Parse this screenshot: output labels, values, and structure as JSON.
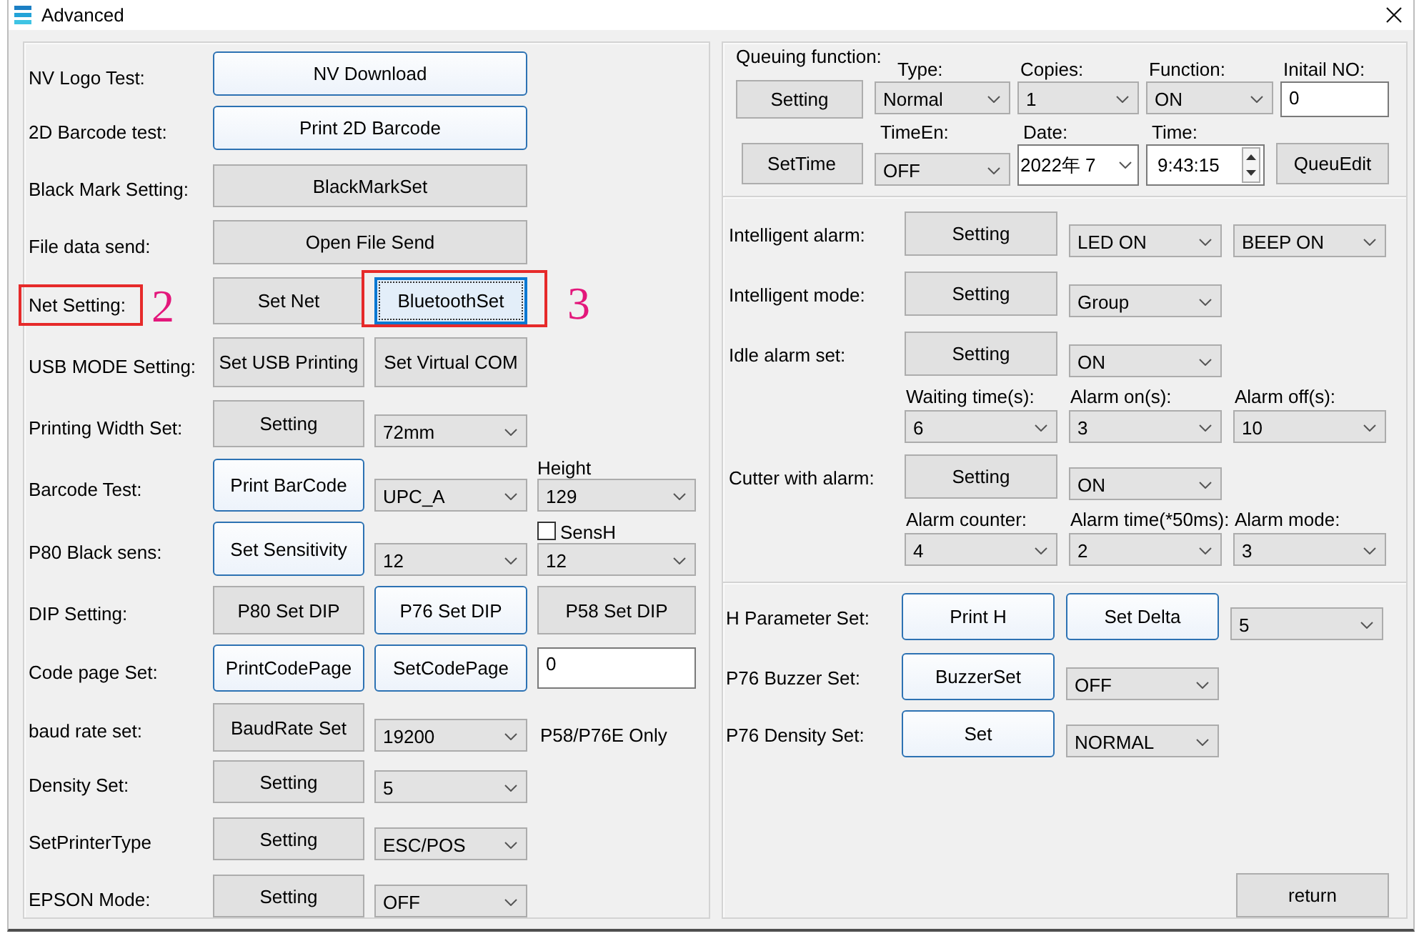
{
  "window": {
    "title": "Advanced"
  },
  "left_panel": {
    "rows": [
      {
        "label": "NV Logo Test:",
        "controls": [
          {
            "kind": "button",
            "text": "NV Download",
            "highlighted": true,
            "focused": false
          }
        ]
      },
      {
        "label": "2D Barcode test:",
        "controls": [
          {
            "kind": "button",
            "text": "Print 2D Barcode",
            "highlighted": true,
            "focused": false
          }
        ]
      },
      {
        "label": "Black Mark Setting:",
        "controls": [
          {
            "kind": "button",
            "text": "BlackMarkSet",
            "highlighted": false,
            "focused": false
          }
        ]
      },
      {
        "label": "File data send:",
        "controls": [
          {
            "kind": "button",
            "text": "Open File Send",
            "highlighted": false,
            "focused": false
          }
        ]
      },
      {
        "label": "Net Setting:",
        "label_callout": "2",
        "controls": [
          {
            "kind": "button",
            "text": "Set Net",
            "highlighted": false,
            "focused": false
          },
          {
            "kind": "button",
            "text": "BluetoothSet",
            "highlighted": false,
            "focused": true,
            "callout": "3"
          }
        ]
      },
      {
        "label": "USB MODE Setting:",
        "controls": [
          {
            "kind": "button",
            "text": "Set USB Printing",
            "highlighted": false,
            "focused": false
          },
          {
            "kind": "button",
            "text": "Set Virtual COM",
            "highlighted": false,
            "focused": false
          }
        ]
      },
      {
        "label": "Printing Width Set:",
        "controls": [
          {
            "kind": "button",
            "text": "Setting",
            "highlighted": false,
            "focused": false
          },
          {
            "kind": "select",
            "value": "72mm"
          }
        ]
      },
      {
        "label": "Barcode Test:",
        "controls": [
          {
            "kind": "button",
            "text": "Print BarCode",
            "highlighted": true,
            "focused": false
          },
          {
            "kind": "select",
            "value": "UPC_A"
          },
          {
            "kind": "select",
            "caption": "Height",
            "value": "129"
          }
        ]
      },
      {
        "label": "P80 Black sens:",
        "controls": [
          {
            "kind": "button",
            "text": "Set Sensitivity",
            "highlighted": true,
            "focused": false
          },
          {
            "kind": "select",
            "value": "12"
          },
          {
            "kind": "select",
            "checkbox": {
              "label": "SensH",
              "checked": false
            },
            "value": "12"
          }
        ]
      },
      {
        "label": "DIP Setting:",
        "controls": [
          {
            "kind": "button",
            "text": "P80 Set DIP",
            "highlighted": false,
            "focused": false
          },
          {
            "kind": "button",
            "text": "P76 Set DIP",
            "highlighted": true,
            "focused": false
          },
          {
            "kind": "button",
            "text": "P58 Set DIP",
            "highlighted": false,
            "focused": false
          }
        ]
      },
      {
        "label": "Code page Set:",
        "controls": [
          {
            "kind": "button",
            "text": "PrintCodePage",
            "highlighted": true,
            "focused": false
          },
          {
            "kind": "button",
            "text": "SetCodePage",
            "highlighted": true,
            "focused": false
          },
          {
            "kind": "input",
            "value": "0"
          }
        ]
      },
      {
        "label": "baud rate set:",
        "controls": [
          {
            "kind": "button",
            "text": "BaudRate Set",
            "highlighted": false,
            "focused": false
          },
          {
            "kind": "select",
            "value": "19200"
          },
          {
            "kind": "note",
            "text": "P58/P76E Only"
          }
        ]
      },
      {
        "label": "Density Set:",
        "controls": [
          {
            "kind": "button",
            "text": "Setting",
            "highlighted": false,
            "focused": false
          },
          {
            "kind": "select",
            "value": "5"
          }
        ]
      },
      {
        "label": "SetPrinterType",
        "controls": [
          {
            "kind": "button",
            "text": "Setting",
            "highlighted": false,
            "focused": false
          },
          {
            "kind": "select",
            "value": "ESC/POS"
          }
        ]
      },
      {
        "label": "EPSON Mode:",
        "controls": [
          {
            "kind": "button",
            "text": "Setting",
            "highlighted": false,
            "focused": false
          },
          {
            "kind": "select",
            "value": "OFF"
          }
        ]
      }
    ]
  },
  "queue": {
    "title": "Queuing function:",
    "setting_button": {
      "text": "Setting",
      "highlighted": false,
      "focused": false
    },
    "top_fields": [
      {
        "kind": "select",
        "label": "Type:",
        "value": "Normal"
      },
      {
        "kind": "select",
        "label": "Copies:",
        "value": "1"
      },
      {
        "kind": "select",
        "label": "Function:",
        "value": "ON"
      },
      {
        "kind": "input",
        "label": "Initail NO:",
        "value": "0"
      }
    ],
    "settime_button": {
      "text": "SetTime",
      "highlighted": false,
      "focused": false
    },
    "bottom_fields": [
      {
        "kind": "select",
        "label": "TimeEn:",
        "value": "OFF"
      },
      {
        "kind": "date",
        "label": "Date:",
        "value": "2022年 7"
      },
      {
        "kind": "time",
        "label": "Time:",
        "value": "9:43:15"
      }
    ],
    "edit_button": {
      "text": "QueuEdit",
      "highlighted": false,
      "focused": false
    }
  },
  "alarms": [
    {
      "label": "Intelligent alarm:",
      "button": {
        "text": "Setting",
        "highlighted": false,
        "focused": false
      },
      "selects": [
        "LED ON",
        "BEEP ON"
      ]
    },
    {
      "label": "Intelligent mode:",
      "button": {
        "text": "Setting",
        "highlighted": false,
        "focused": false
      },
      "selects": [
        "Group"
      ]
    },
    {
      "label": "Idle alarm set:",
      "button": {
        "text": "Setting",
        "highlighted": false,
        "focused": false
      },
      "selects": [
        "ON"
      ],
      "options": [
        {
          "label": "Waiting time(s):",
          "value": "6"
        },
        {
          "label": "Alarm on(s):",
          "value": "3"
        },
        {
          "label": "Alarm off(s):",
          "value": "10"
        }
      ]
    },
    {
      "label": "Cutter with alarm:",
      "button": {
        "text": "Setting",
        "highlighted": false,
        "focused": false
      },
      "selects": [
        "ON"
      ],
      "options": [
        {
          "label": "Alarm counter:",
          "value": "4"
        },
        {
          "label": "Alarm time(*50ms):",
          "value": "2"
        },
        {
          "label": "Alarm mode:",
          "value": "3"
        }
      ]
    }
  ],
  "printer_settings": [
    {
      "label": "H Parameter Set:",
      "controls": [
        {
          "kind": "button",
          "text": "Print H",
          "highlighted": true,
          "focused": false
        },
        {
          "kind": "button",
          "text": "Set Delta",
          "highlighted": true,
          "focused": false
        },
        {
          "kind": "select",
          "value": "5"
        }
      ]
    },
    {
      "label": "P76 Buzzer Set:",
      "controls": [
        {
          "kind": "button",
          "text": "BuzzerSet",
          "highlighted": true,
          "focused": false
        },
        {
          "kind": "select",
          "value": "OFF"
        }
      ]
    },
    {
      "label": "P76 Density Set:",
      "controls": [
        {
          "kind": "button",
          "text": "Set",
          "highlighted": true,
          "focused": false
        },
        {
          "kind": "select",
          "value": "NORMAL"
        }
      ]
    }
  ],
  "return_button": {
    "text": "return",
    "highlighted": false,
    "focused": false
  }
}
